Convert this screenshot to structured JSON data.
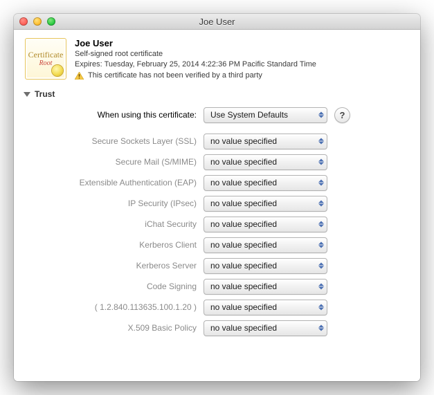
{
  "window": {
    "title": "Joe User"
  },
  "certificate": {
    "name": "Joe User",
    "kind": "Self-signed root certificate",
    "expires": "Expires: Tuesday, February 25, 2014 4:22:36 PM Pacific Standard Time",
    "warning": "This certificate has not been verified by a third party",
    "icon": {
      "line1": "Certificate",
      "line2": "Root"
    }
  },
  "trust": {
    "heading": "Trust",
    "primary": {
      "label": "When using this certificate:",
      "value": "Use System Defaults",
      "help": "?"
    },
    "policies": [
      {
        "label": "Secure Sockets Layer (SSL)",
        "value": "no value specified"
      },
      {
        "label": "Secure Mail (S/MIME)",
        "value": "no value specified"
      },
      {
        "label": "Extensible Authentication (EAP)",
        "value": "no value specified"
      },
      {
        "label": "IP Security (IPsec)",
        "value": "no value specified"
      },
      {
        "label": "iChat Security",
        "value": "no value specified"
      },
      {
        "label": "Kerberos Client",
        "value": "no value specified"
      },
      {
        "label": "Kerberos Server",
        "value": "no value specified"
      },
      {
        "label": "Code Signing",
        "value": "no value specified"
      },
      {
        "label": "( 1.2.840.113635.100.1.20 )",
        "value": "no value specified"
      },
      {
        "label": "X.509 Basic Policy",
        "value": "no value specified"
      }
    ]
  }
}
